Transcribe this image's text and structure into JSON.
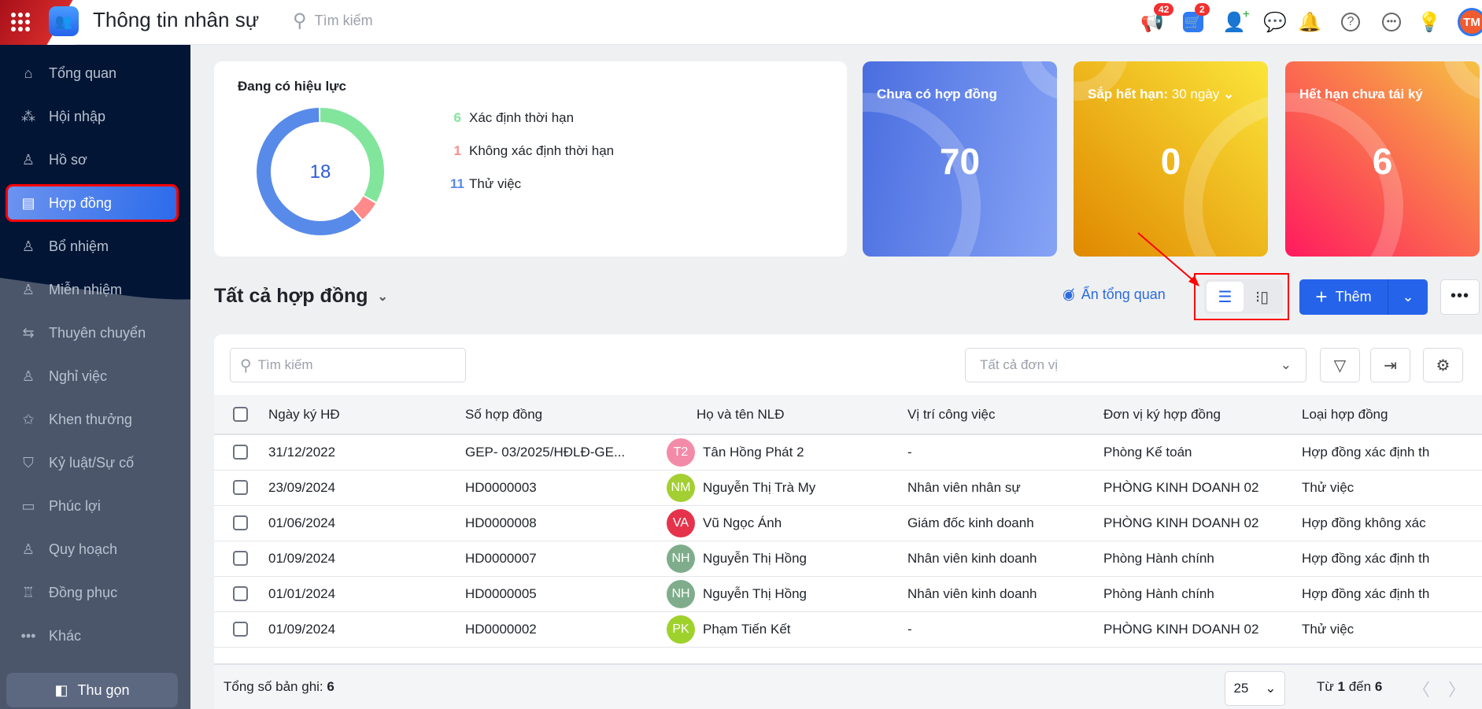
{
  "header": {
    "title": "Thông tin nhân sự",
    "search_placeholder": "Tìm kiếm",
    "announcement_badge": "42",
    "cart_badge": "2",
    "avatar_initials": "TM"
  },
  "sidebar": {
    "items": [
      {
        "label": "Tổng quan",
        "icon": "⌂"
      },
      {
        "label": "Hội nhập",
        "icon": "⁂"
      },
      {
        "label": "Hồ sơ",
        "icon": "♙"
      },
      {
        "label": "Hợp đồng",
        "icon": "▤"
      },
      {
        "label": "Bổ nhiệm",
        "icon": "♙"
      },
      {
        "label": "Miễn nhiệm",
        "icon": "♙"
      },
      {
        "label": "Thuyên chuyển",
        "icon": "⇆"
      },
      {
        "label": "Nghỉ việc",
        "icon": "♙"
      },
      {
        "label": "Khen thưởng",
        "icon": "✩"
      },
      {
        "label": "Kỷ luật/Sự cố",
        "icon": "⛉"
      },
      {
        "label": "Phúc lợi",
        "icon": "▭"
      },
      {
        "label": "Quy hoạch",
        "icon": "♙"
      },
      {
        "label": "Đồng phục",
        "icon": "♖"
      },
      {
        "label": "Khác",
        "icon": "•••"
      }
    ],
    "collapse_label": "Thu gọn"
  },
  "summary": {
    "title": "Đang có hiệu lực",
    "total": "18"
  },
  "chart_data": {
    "type": "pie",
    "title": "Đang có hiệu lực",
    "center_label": "18",
    "slices": [
      {
        "label": "Xác định thời hạn",
        "value": 6,
        "color": "#82e59c"
      },
      {
        "label": "Không xác định thời hạn",
        "value": 1,
        "color": "#ff8a8a"
      },
      {
        "label": "Thử việc",
        "value": 11,
        "color": "#588ae9"
      }
    ]
  },
  "stats": [
    {
      "label": "Chưa có hợp đồng",
      "value": "70"
    },
    {
      "label": "Sắp hết hạn:",
      "period": "30 ngày",
      "value": "0"
    },
    {
      "label": "Hết hạn chưa tái ký",
      "value": "6"
    }
  ],
  "toolbar": {
    "list_title": "Tất cả hợp đồng",
    "hide_overview": "Ẩn tổng quan",
    "add_label": "Thêm"
  },
  "table": {
    "search_placeholder": "Tìm kiếm",
    "unit_placeholder": "Tất cả đơn vị",
    "columns": [
      "Ngày ký HĐ",
      "Số hợp đồng",
      "Họ và tên NLĐ",
      "Vị trí công việc",
      "Đơn vị ký hợp đồng",
      "Loại hợp đồng"
    ],
    "rows": [
      {
        "date": "31/12/2022",
        "number": "GEP- 03/2025/HĐLĐ-GE...",
        "initials": "T2",
        "color": "#f38ba8",
        "name": "Tân Hồng Phát 2",
        "position": "-",
        "unit": "Phòng Kế toán",
        "type": "Hợp đồng xác định th"
      },
      {
        "date": "23/09/2024",
        "number": "HD0000003",
        "initials": "NM",
        "color": "#a3cf32",
        "name": "Nguyễn Thị Trà My",
        "position": "Nhân viên nhân sự",
        "unit": "PHÒNG KINH DOANH 02",
        "type": "Thử việc"
      },
      {
        "date": "01/06/2024",
        "number": "HD0000008",
        "initials": "VA",
        "color": "#e5334b",
        "name": "Vũ Ngọc Ánh",
        "position": "Giám đốc kinh doanh",
        "unit": "PHÒNG KINH DOANH 02",
        "type": "Hợp đồng không xác"
      },
      {
        "date": "01/09/2024",
        "number": "HD0000007",
        "initials": "NH",
        "color": "#7fad8c",
        "name": "Nguyễn Thị Hồng",
        "position": "Nhân viên kinh doanh",
        "unit": "Phòng Hành chính",
        "type": "Hợp đồng xác định th"
      },
      {
        "date": "01/01/2024",
        "number": "HD0000005",
        "initials": "NH",
        "color": "#7fad8c",
        "name": "Nguyễn Thị Hồng",
        "position": "Nhân viên kinh doanh",
        "unit": "Phòng Hành chính",
        "type": "Hợp đồng xác định th"
      },
      {
        "date": "01/09/2024",
        "number": "HD0000002",
        "initials": "PK",
        "color": "#9fd12d",
        "name": "Phạm Tiến Kết",
        "position": "-",
        "unit": "PHÒNG KINH DOANH 02",
        "type": "Thử việc"
      }
    ]
  },
  "footer": {
    "total_label": "Tổng số bản ghi:",
    "total": "6",
    "page_size": "25",
    "range_prefix": "Từ",
    "range_from": "1",
    "range_mid": "đến",
    "range_to": "6"
  }
}
